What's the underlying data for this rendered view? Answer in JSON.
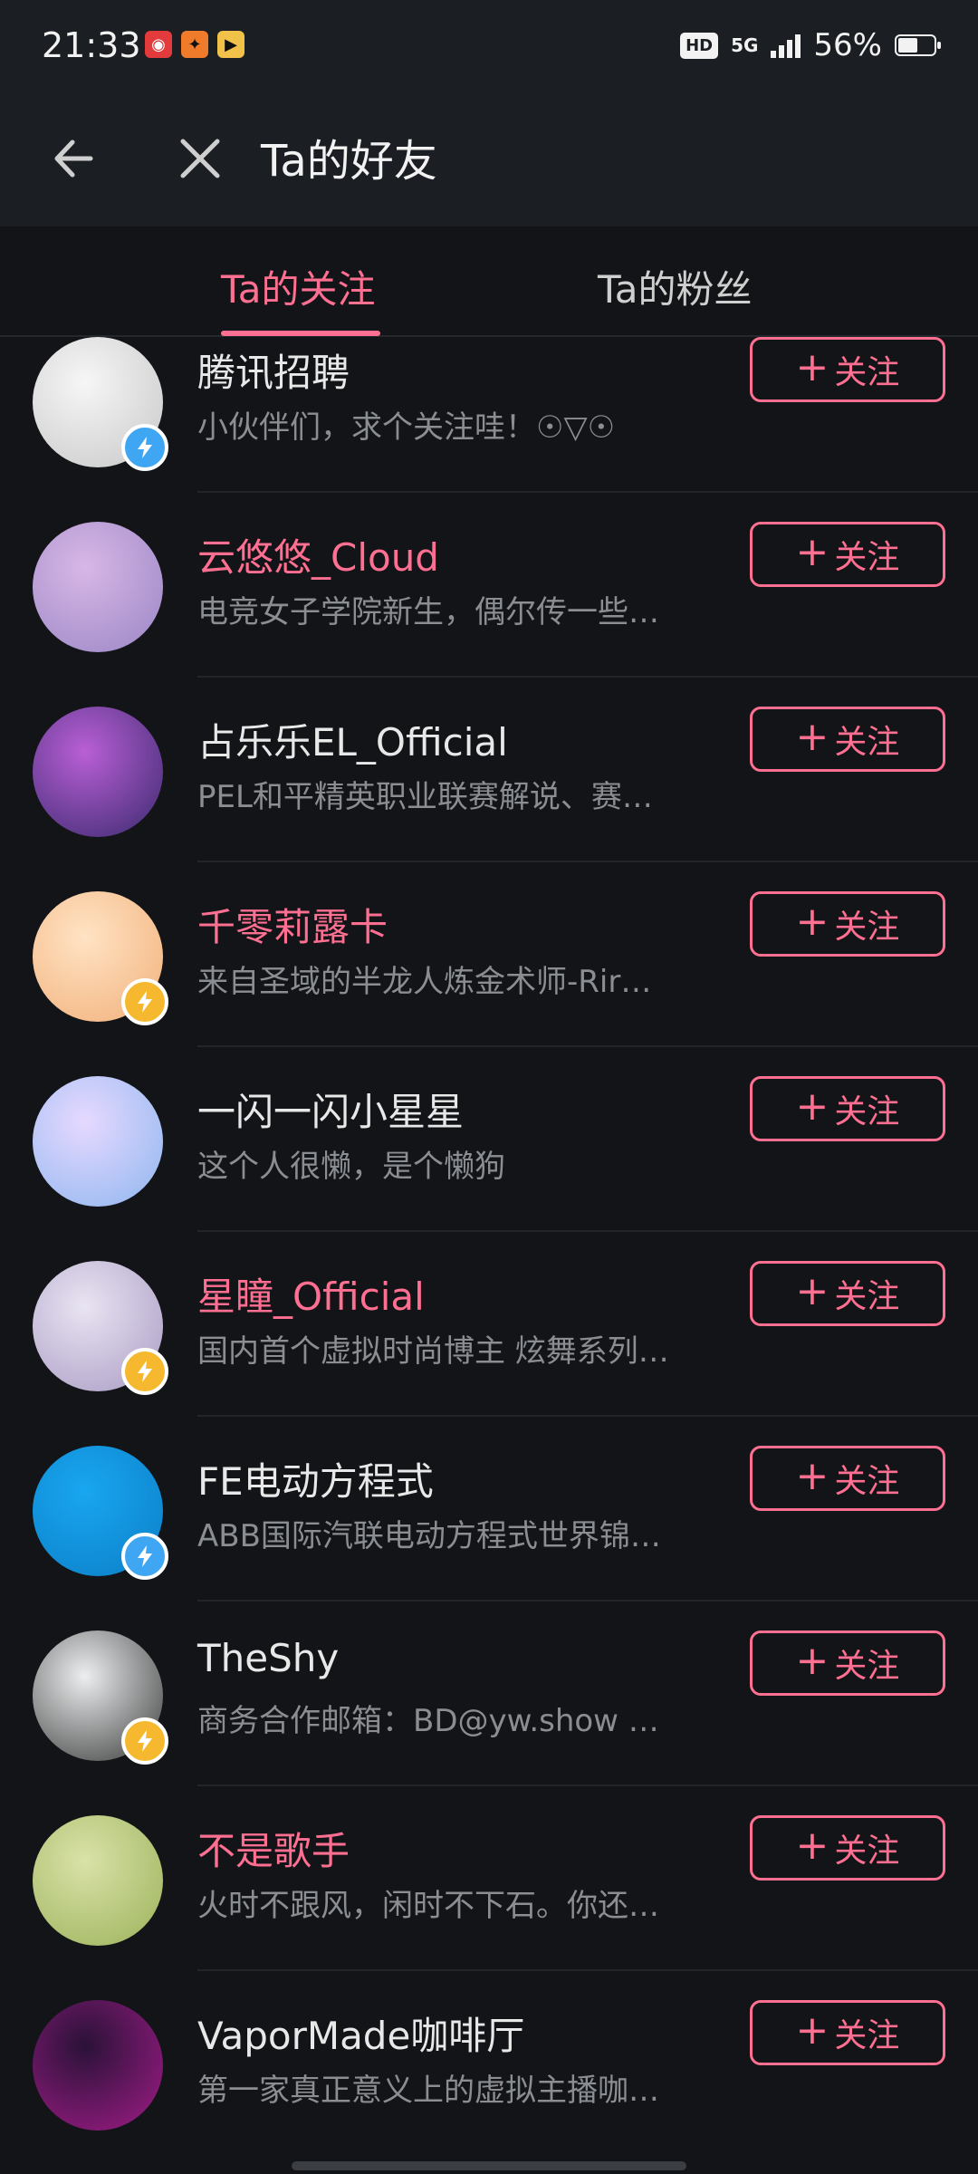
{
  "status_bar": {
    "time": "21:33",
    "hd": "HD",
    "network": "5G",
    "battery": "56%",
    "battery_level": 0.56
  },
  "header": {
    "title": "Ta的好友",
    "back_icon": "arrow-left-icon",
    "close_icon": "close-icon"
  },
  "tabs": [
    {
      "label": "Ta的关注",
      "active": true
    },
    {
      "label": "Ta的粉丝",
      "active": false
    }
  ],
  "follow_label": "关注",
  "users": [
    {
      "name": "腾讯招聘",
      "bio": "小伙伴们，求个关注哇！☉▽☉",
      "name_color": "#e8e8e8",
      "avatar_colors": [
        "#f6f6f6",
        "#c8c8c8"
      ],
      "badge": "blue",
      "avatar_icon": "penguin-avatar"
    },
    {
      "name": "云悠悠_Cloud",
      "bio": "电竞女子学院新生，偶尔传一些…",
      "name_color": "#ff6f91",
      "avatar_colors": [
        "#d8b7e6",
        "#9a86c5"
      ],
      "badge": "",
      "avatar_icon": "girl-avatar"
    },
    {
      "name": "占乐乐EL_Official",
      "bio": "PEL和平精英职业联赛解说、赛…",
      "name_color": "#e8e8e8",
      "avatar_colors": [
        "#b95fd6",
        "#3a2a6e"
      ],
      "badge": "",
      "avatar_icon": "girl-avatar"
    },
    {
      "name": "千零莉露卡",
      "bio": "来自圣域的半龙人炼金术师-Rir…",
      "name_color": "#ff6f91",
      "avatar_colors": [
        "#ffe3c4",
        "#f2b07a"
      ],
      "badge": "yellow",
      "avatar_icon": "anime-avatar"
    },
    {
      "name": "一闪一闪小星星",
      "bio": "这个人很懒，是个懒狗",
      "name_color": "#e8e8e8",
      "avatar_colors": [
        "#e6d9ff",
        "#8fb6ef"
      ],
      "badge": "",
      "avatar_icon": "bunny-avatar"
    },
    {
      "name": "星瞳_Official",
      "bio": "国内首个虚拟时尚博主 炫舞系列…",
      "name_color": "#ff6f91",
      "avatar_colors": [
        "#e9e4f2",
        "#a99bc4"
      ],
      "badge": "yellow",
      "avatar_icon": "girl-avatar"
    },
    {
      "name": "FE电动方程式",
      "bio": "ABB国际汽联电动方程式世界锦…",
      "name_color": "#e8e8e8",
      "avatar_colors": [
        "#19a6f0",
        "#0b7fc7"
      ],
      "badge": "blue",
      "avatar_icon": "formula-e-logo"
    },
    {
      "name": "TheShy",
      "bio": "商务合作邮箱：BD@yw.show …",
      "name_color": "#e8e8e8",
      "avatar_colors": [
        "#eceeef",
        "#3a3a3a"
      ],
      "badge": "yellow",
      "avatar_icon": "person-avatar"
    },
    {
      "name": "不是歌手",
      "bio": "火时不跟风，闲时不下石。你还…",
      "name_color": "#ff6f91",
      "avatar_colors": [
        "#d9e2a8",
        "#9cb25a"
      ],
      "badge": "",
      "avatar_icon": "pig-avatar"
    },
    {
      "name": "VaporMade咖啡厅",
      "bio": "第一家真正意义上的虚拟主播咖…",
      "name_color": "#e8e8e8",
      "avatar_colors": [
        "#2a1238",
        "#a01c87"
      ],
      "badge": "",
      "avatar_icon": "vapor-maid-logo"
    }
  ]
}
